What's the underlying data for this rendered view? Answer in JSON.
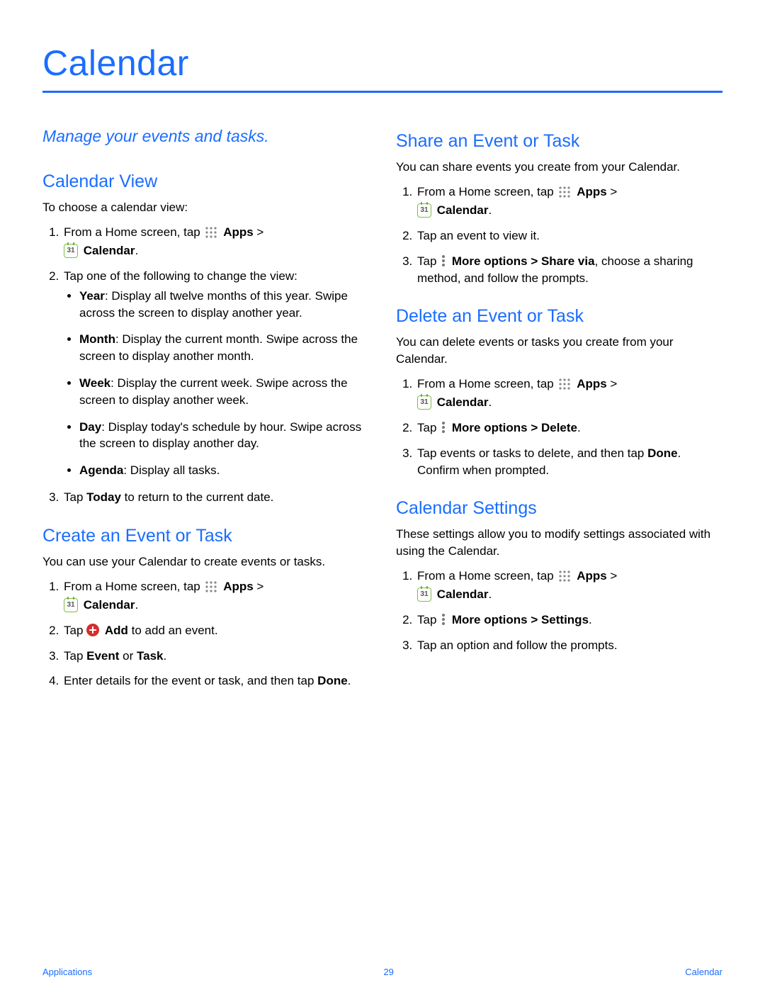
{
  "title": "Calendar",
  "intro": "Manage your events and tasks.",
  "cal_day": "31",
  "left": {
    "view": {
      "heading": "Calendar View",
      "intro": "To choose a calendar view:",
      "step1_a": "From a Home screen, tap ",
      "step1_b": "Apps",
      "step1_c": " > ",
      "step1_d": "Calendar",
      "step1_e": ".",
      "step2": "Tap one of the following to change the view:",
      "bul1_a": "Year",
      "bul1_b": ": Display all twelve months of this year. Swipe across the screen to display another year.",
      "bul2_a": "Month",
      "bul2_b": ": Display the current month. Swipe across the screen to display another month.",
      "bul3_a": "Week",
      "bul3_b": ": Display the current week. Swipe across the screen to display another week.",
      "bul4_a": "Day",
      "bul4_b": ": Display today's schedule by hour. Swipe across the screen to display another day.",
      "bul5_a": "Agenda",
      "bul5_b": ": Display all tasks.",
      "step3_a": "Tap ",
      "step3_b": "Today",
      "step3_c": " to return to the current date."
    },
    "create": {
      "heading": "Create an Event or Task",
      "intro": "You can use your Calendar to create events or tasks.",
      "step2_a": "Tap ",
      "step2_b": "Add",
      "step2_c": " to add an event.",
      "step3_a": "Tap ",
      "step3_b": "Event",
      "step3_c": " or ",
      "step3_d": "Task",
      "step3_e": ".",
      "step4_a": "Enter details for the event or task, and then tap ",
      "step4_b": "Done",
      "step4_c": "."
    }
  },
  "right": {
    "share": {
      "heading": "Share an Event or Task",
      "intro": "You can share events you create from your Calendar.",
      "step2": "Tap an event to view it.",
      "step3_a": "Tap ",
      "step3_b": "More options > Share via",
      "step3_c": ", choose a sharing method, and follow the prompts."
    },
    "delete": {
      "heading": "Delete an Event or Task",
      "intro": "You can delete events or tasks you create from your Calendar.",
      "step2_a": "Tap ",
      "step2_b": "More options > Delete",
      "step2_c": ".",
      "step3_a": "Tap events or tasks to delete, and then tap ",
      "step3_b": "Done",
      "step3_c": ". Confirm when prompted."
    },
    "settings": {
      "heading": "Calendar Settings",
      "intro": "These settings allow you to modify settings associated with using the Calendar.",
      "step2_a": "Tap ",
      "step2_b": "More options > Settings",
      "step2_c": ".",
      "step3": "Tap an option and follow the prompts."
    }
  },
  "footer": {
    "left": "Applications",
    "center": "29",
    "right": "Calendar"
  }
}
